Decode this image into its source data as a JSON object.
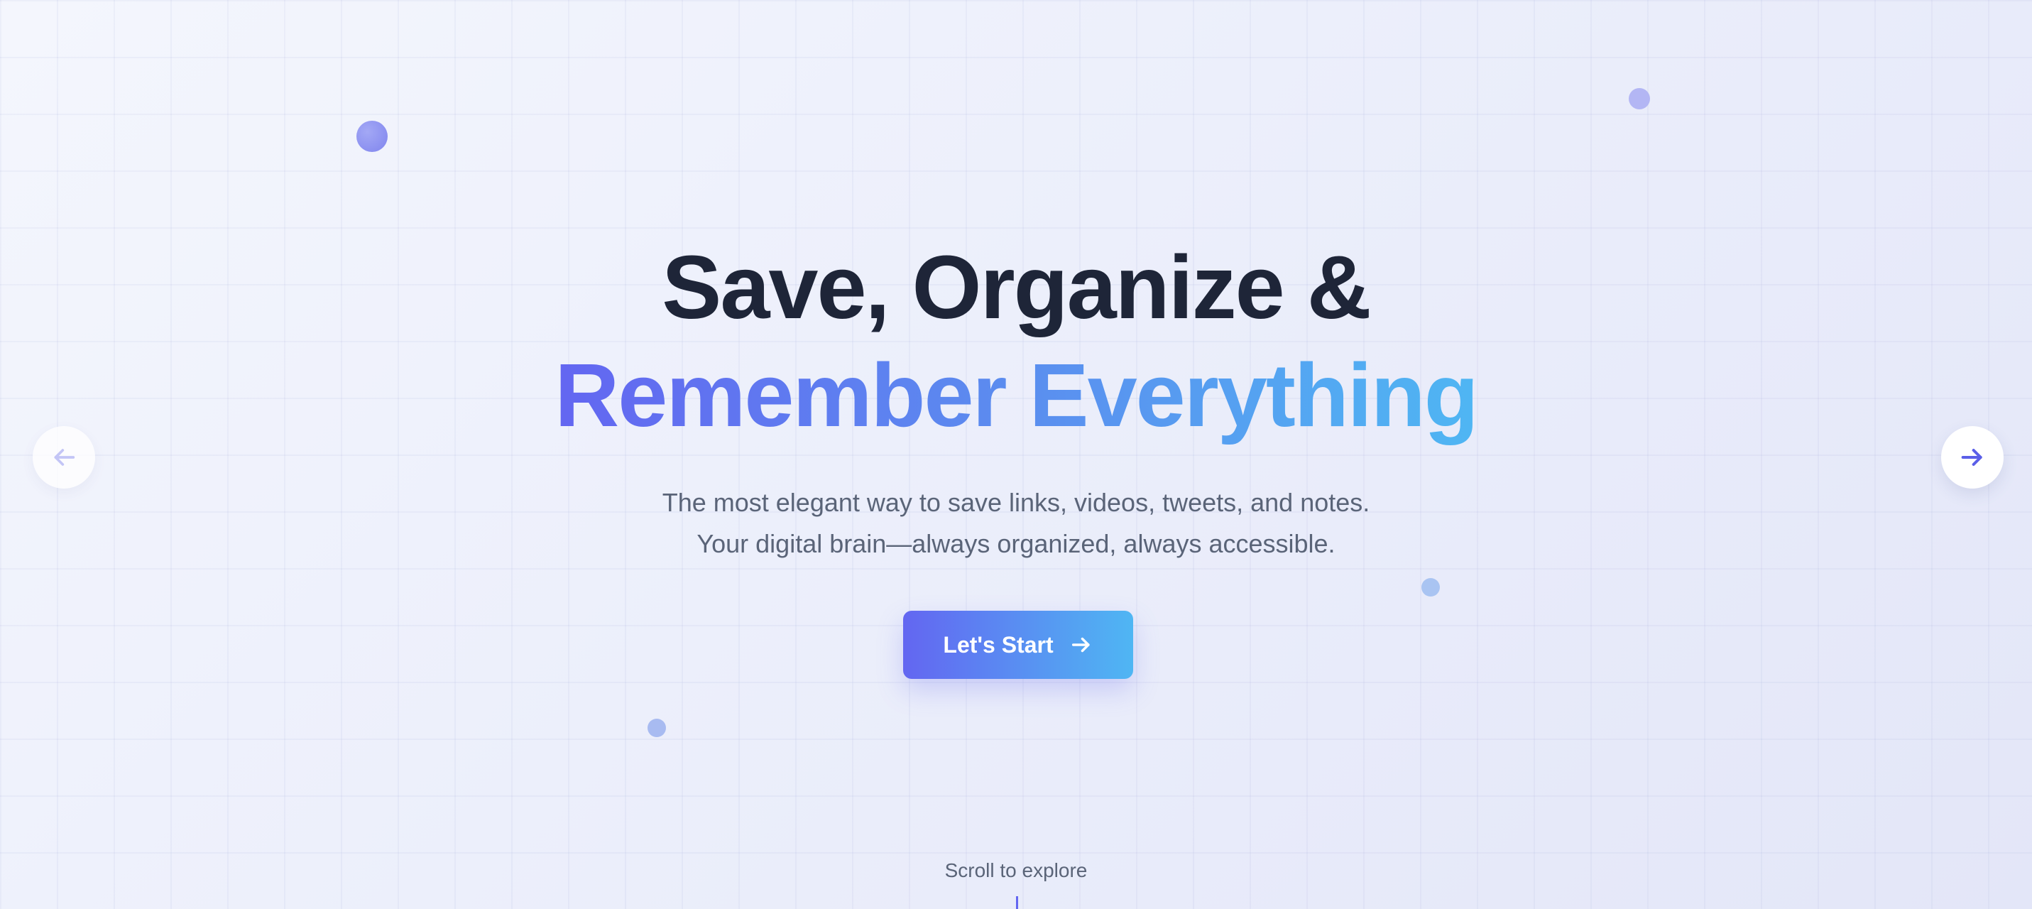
{
  "hero": {
    "title_line_1": "Save, Organize &",
    "title_line_2": "Remember Everything",
    "subtitle_line_1": "The most elegant way to save links, videos, tweets, and notes.",
    "subtitle_line_2": "Your digital brain—always organized, always accessible."
  },
  "cta": {
    "label": "Let's Start",
    "icon": "arrow-right-icon"
  },
  "navigation": {
    "prev_icon": "arrow-left-icon",
    "next_icon": "arrow-right-icon"
  },
  "scroll_hint": {
    "label": "Scroll to explore"
  },
  "colors": {
    "accent_start": "#6366f1",
    "accent_end": "#4fb6f3",
    "heading": "#1e2538",
    "body_text": "#5a6478"
  }
}
